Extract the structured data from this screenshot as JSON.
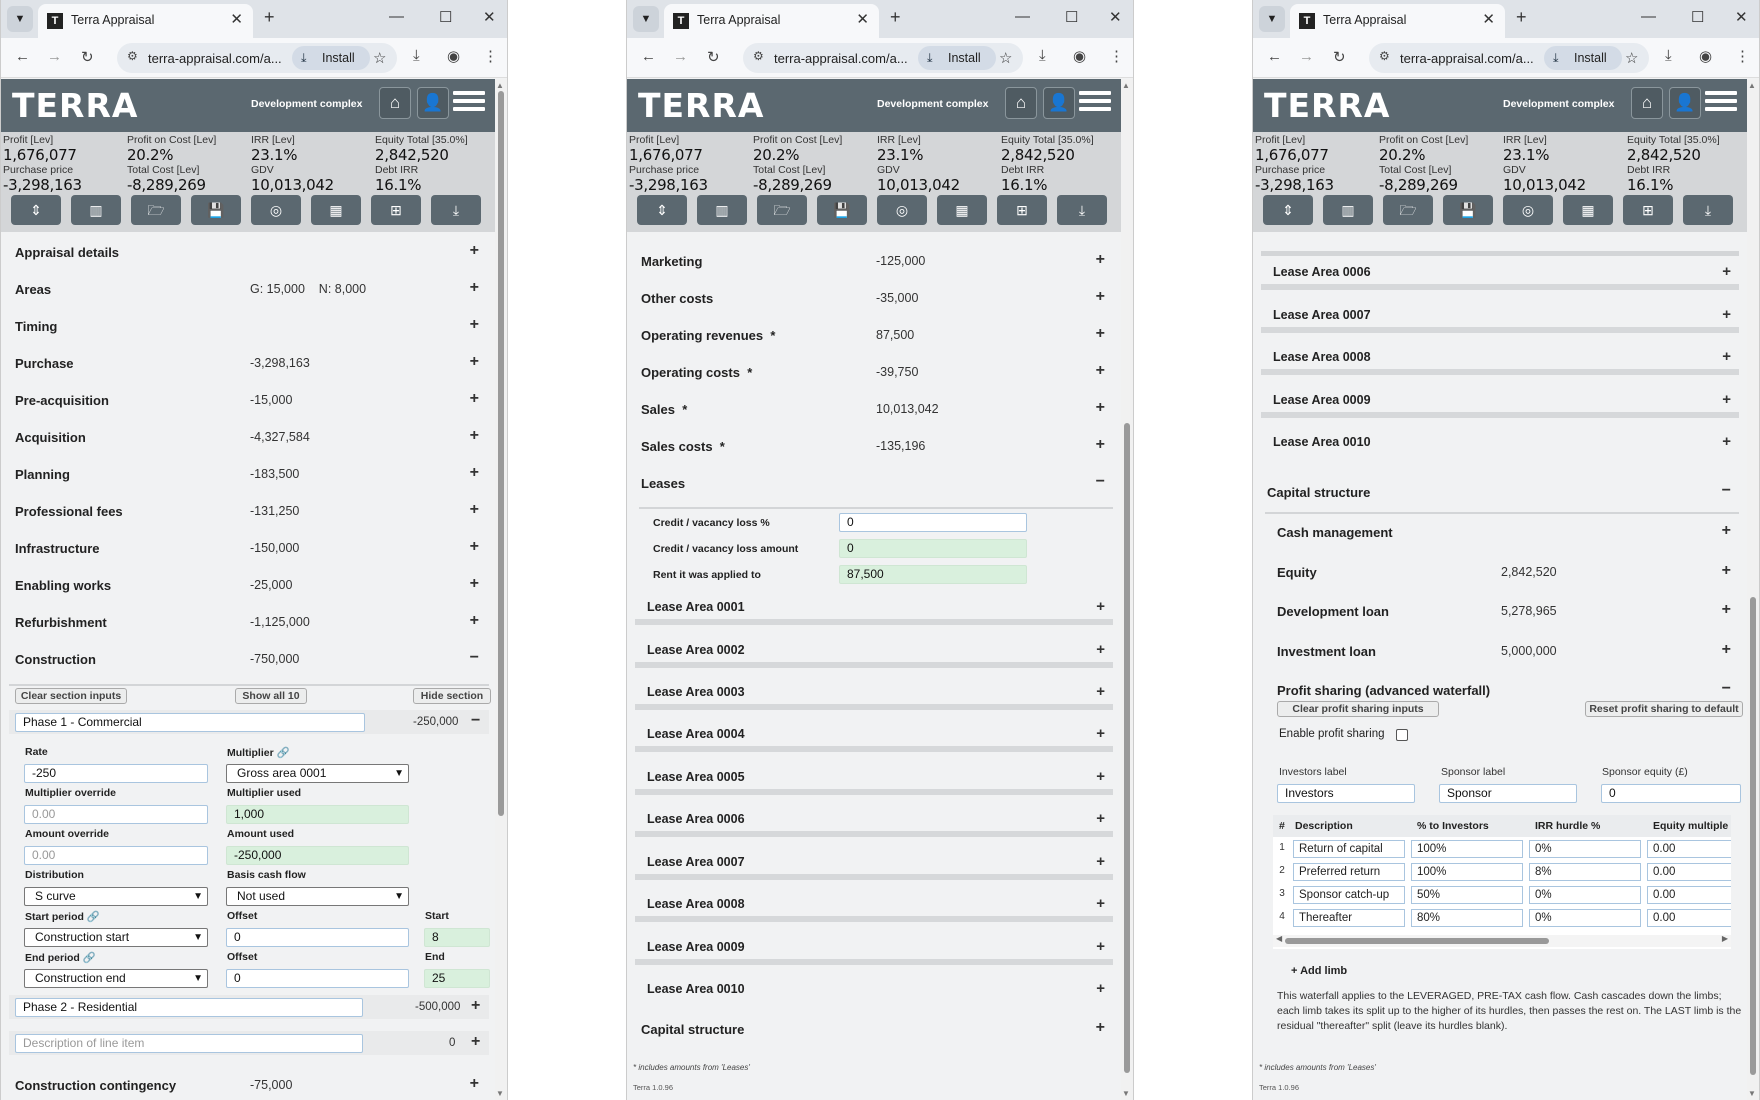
{
  "browser": {
    "tab_title": "Terra Appraisal",
    "url": "terra-appraisal.com/a...",
    "install_label": "Install"
  },
  "app": {
    "logo": "TERRA",
    "project": "Development complex",
    "version": "Terra 1.0.96",
    "footnote": "* includes amounts from 'Leases'"
  },
  "metrics": [
    {
      "label": "Profit [Lev]",
      "value": "1,676,077"
    },
    {
      "label": "Profit on Cost [Lev]",
      "value": "20.2%"
    },
    {
      "label": "IRR [Lev]",
      "value": "23.1%"
    },
    {
      "label": "Equity Total [35.0%]",
      "value": "2,842,520"
    },
    {
      "label": "Purchase price",
      "value": "-3,298,163"
    },
    {
      "label": "Total Cost [Lev]",
      "value": "-8,289,269"
    },
    {
      "label": "GDV",
      "value": "10,013,042"
    },
    {
      "label": "Debt IRR",
      "value": "16.1%"
    }
  ],
  "panel1": {
    "sections": [
      {
        "label": "Appraisal details",
        "value": "",
        "toggle": "+"
      },
      {
        "label": "Areas",
        "value": "G: 15,000    N: 8,000",
        "toggle": "+"
      },
      {
        "label": "Timing",
        "value": "",
        "toggle": "+"
      },
      {
        "label": "Purchase",
        "value": "-3,298,163",
        "toggle": "+"
      },
      {
        "label": "Pre-acquisition",
        "value": "-15,000",
        "toggle": "+"
      },
      {
        "label": "Acquisition",
        "value": "-4,327,584",
        "toggle": "+"
      },
      {
        "label": "Planning",
        "value": "-183,500",
        "toggle": "+"
      },
      {
        "label": "Professional fees",
        "value": "-131,250",
        "toggle": "+"
      },
      {
        "label": "Infrastructure",
        "value": "-150,000",
        "toggle": "+"
      },
      {
        "label": "Enabling works",
        "value": "-25,000",
        "toggle": "+"
      },
      {
        "label": "Refurbishment",
        "value": "-1,125,000",
        "toggle": "+"
      },
      {
        "label": "Construction",
        "value": "-750,000",
        "toggle": "−"
      }
    ],
    "clear_section": "Clear section inputs",
    "show_all": "Show all 10",
    "hide_section": "Hide section",
    "phase1": {
      "name": "Phase 1 - Commercial",
      "amount": "-250,000",
      "toggle": "−"
    },
    "fields": {
      "rate_label": "Rate",
      "rate": "-250",
      "multiplier_label": "Multiplier",
      "multiplier": "Gross area 0001",
      "mult_override_label": "Multiplier override",
      "mult_override_ph": "0.00",
      "mult_used_label": "Multiplier used",
      "mult_used": "1,000",
      "amount_override_label": "Amount override",
      "amount_override_ph": "0.00",
      "amount_used_label": "Amount used",
      "amount_used": "-250,000",
      "distribution_label": "Distribution",
      "distribution": "S curve",
      "basis_label": "Basis cash flow",
      "basis": "Not used",
      "start_period_label": "Start period",
      "start_period": "Construction start",
      "offset_label": "Offset",
      "start_offset": "0",
      "start_label": "Start",
      "start": "8",
      "end_period_label": "End period",
      "end_period": "Construction end",
      "end_offset": "0",
      "end_label": "End",
      "end": "25"
    },
    "phase2": {
      "name": "Phase 2 - Residential",
      "amount": "-500,000",
      "toggle": "+"
    },
    "new_item": {
      "placeholder": "Description of line item",
      "amount": "0",
      "toggle": "+"
    },
    "contingency": {
      "label": "Construction contingency",
      "value": "-75,000",
      "toggle": "+"
    }
  },
  "panel2": {
    "sections": [
      {
        "label": "Marketing",
        "value": "-125,000",
        "toggle": "+"
      },
      {
        "label": "Other costs",
        "value": "-35,000",
        "toggle": "+"
      },
      {
        "label": "Operating revenues  *",
        "value": "87,500",
        "toggle": "+"
      },
      {
        "label": "Operating costs  *",
        "value": "-39,750",
        "toggle": "+"
      },
      {
        "label": "Sales  *",
        "value": "10,013,042",
        "toggle": "+"
      },
      {
        "label": "Sales costs  *",
        "value": "-135,196",
        "toggle": "+"
      },
      {
        "label": "Leases",
        "value": "",
        "toggle": "−"
      }
    ],
    "vacancy_pct_label": "Credit / vacancy loss %",
    "vacancy_pct": "0",
    "vacancy_amt_label": "Credit / vacancy loss amount",
    "vacancy_amt": "0",
    "rent_applied_label": "Rent it was applied to",
    "rent_applied": "87,500",
    "lease_areas": [
      "Lease Area 0001",
      "Lease Area 0002",
      "Lease Area 0003",
      "Lease Area 0004",
      "Lease Area 0005",
      "Lease Area 0006",
      "Lease Area 0007",
      "Lease Area 0008",
      "Lease Area 0009",
      "Lease Area 0010"
    ],
    "capital": {
      "label": "Capital structure",
      "toggle": "+"
    }
  },
  "panel3": {
    "lease_areas": [
      "Lease Area 0006",
      "Lease Area 0007",
      "Lease Area 0008",
      "Lease Area 0009",
      "Lease Area 0010"
    ],
    "capital": {
      "label": "Capital structure",
      "toggle": "−"
    },
    "subs": [
      {
        "label": "Cash management",
        "value": "",
        "toggle": "+"
      },
      {
        "label": "Equity",
        "value": "2,842,520",
        "toggle": "+"
      },
      {
        "label": "Development loan",
        "value": "5,278,965",
        "toggle": "+"
      },
      {
        "label": "Investment loan",
        "value": "5,000,000",
        "toggle": "+"
      },
      {
        "label": "Profit sharing (advanced waterfall)",
        "value": "",
        "toggle": "−"
      }
    ],
    "clear_profit": "Clear profit sharing inputs",
    "reset_profit": "Reset profit sharing to default",
    "enable_label": "Enable profit sharing",
    "investors_label_lbl": "Investors label",
    "investors_label": "Investors",
    "sponsor_label_lbl": "Sponsor label",
    "sponsor_label": "Sponsor",
    "sponsor_equity_lbl": "Sponsor equity (£)",
    "sponsor_equity": "0",
    "table_headers": [
      "#",
      "Description",
      "% to Investors",
      "IRR hurdle %",
      "Equity multiple"
    ],
    "limbs": [
      {
        "n": "1",
        "desc": "Return of capital",
        "pct": "100%",
        "irr": "0%",
        "eq": "0.00"
      },
      {
        "n": "2",
        "desc": "Preferred return",
        "pct": "100%",
        "irr": "8%",
        "eq": "0.00"
      },
      {
        "n": "3",
        "desc": "Sponsor catch-up",
        "pct": "50%",
        "irr": "0%",
        "eq": "0.00"
      },
      {
        "n": "4",
        "desc": "Thereafter",
        "pct": "80%",
        "irr": "0%",
        "eq": "0.00"
      }
    ],
    "add_limb": "+ Add limb",
    "note": "This waterfall applies to the LEVERAGED, PRE-TAX cash flow. Cash cascades down the limbs; each limb takes its split up to the higher of its hurdles, then passes the rest on. The LAST limb is the residual \"thereafter\" split (leave its hurdles blank)."
  }
}
